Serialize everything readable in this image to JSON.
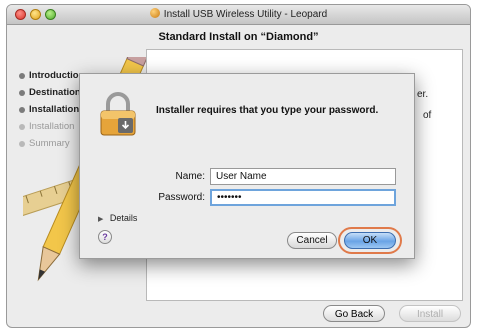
{
  "window": {
    "title": "Install USB Wireless Utility - Leopard",
    "header": "Standard Install on “Diamond”"
  },
  "sidebar": {
    "steps": [
      {
        "label": "Introduction",
        "state": "done"
      },
      {
        "label": "Destination Select",
        "state": "done"
      },
      {
        "label": "Installation Type",
        "state": "current"
      },
      {
        "label": "Installation",
        "state": "upcoming"
      },
      {
        "label": "Summary",
        "state": "upcoming"
      }
    ]
  },
  "content": {
    "fragment_1": "er.",
    "fragment_2": "of"
  },
  "footer": {
    "go_back_label": "Go Back",
    "install_label": "Install"
  },
  "auth_dialog": {
    "prompt": "Installer requires that you type your password.",
    "name_label": "Name:",
    "name_value": "User Name",
    "password_label": "Password:",
    "password_value": "•••••••",
    "details_label": "Details",
    "help_label": "?",
    "cancel_label": "Cancel",
    "ok_label": "OK"
  },
  "colors": {
    "ok_highlight_ring": "#e07a4a",
    "focus_ring": "#6ea4dc"
  }
}
